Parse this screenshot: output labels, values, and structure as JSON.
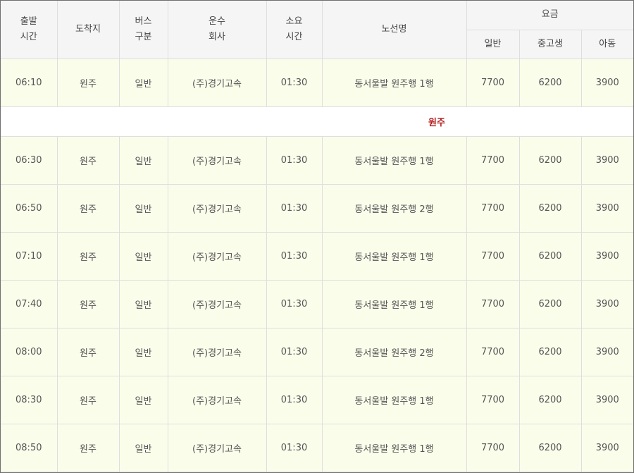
{
  "headers": {
    "departure": [
      "출발",
      "시간"
    ],
    "destination": "도착지",
    "bus_type": [
      "버스",
      "구분"
    ],
    "company": [
      "운수",
      "회사"
    ],
    "duration": [
      "소요",
      "시간"
    ],
    "route": "노선명",
    "fare": "요금",
    "fare_general": "일반",
    "fare_student": "중고생",
    "fare_child": "아동"
  },
  "first_row": {
    "time": "06:10",
    "dest": "원주",
    "type": "일반",
    "company": "(주)경기고속",
    "duration": "01:30",
    "route": "동서울발 원주행 1행",
    "general": "7700",
    "student": "6200",
    "child": "3900"
  },
  "section_label": "원주",
  "rows": [
    {
      "time": "06:30",
      "dest": "원주",
      "type": "일반",
      "company": "(주)경기고속",
      "duration": "01:30",
      "route": "동서울발 원주행 1행",
      "general": "7700",
      "student": "6200",
      "child": "3900"
    },
    {
      "time": "06:50",
      "dest": "원주",
      "type": "일반",
      "company": "(주)경기고속",
      "duration": "01:30",
      "route": "동서울발 원주행 2행",
      "general": "7700",
      "student": "6200",
      "child": "3900"
    },
    {
      "time": "07:10",
      "dest": "원주",
      "type": "일반",
      "company": "(주)경기고속",
      "duration": "01:30",
      "route": "동서울발 원주행 1행",
      "general": "7700",
      "student": "6200",
      "child": "3900"
    },
    {
      "time": "07:40",
      "dest": "원주",
      "type": "일반",
      "company": "(주)경기고속",
      "duration": "01:30",
      "route": "동서울발 원주행 1행",
      "general": "7700",
      "student": "6200",
      "child": "3900"
    },
    {
      "time": "08:00",
      "dest": "원주",
      "type": "일반",
      "company": "(주)경기고속",
      "duration": "01:30",
      "route": "동서울발 원주행 2행",
      "general": "7700",
      "student": "6200",
      "child": "3900"
    },
    {
      "time": "08:30",
      "dest": "원주",
      "type": "일반",
      "company": "(주)경기고속",
      "duration": "01:30",
      "route": "동서울발 원주행 1행",
      "general": "7700",
      "student": "6200",
      "child": "3900"
    },
    {
      "time": "08:50",
      "dest": "원주",
      "type": "일반",
      "company": "(주)경기고속",
      "duration": "01:30",
      "route": "동서울발 원주행 1행",
      "general": "7700",
      "student": "6200",
      "child": "3900"
    }
  ],
  "colors": {
    "row_bg": "#fbfdeb",
    "header_bg": "#f5f5f5",
    "section_text": "#b21d1d",
    "border": "#dedede"
  }
}
